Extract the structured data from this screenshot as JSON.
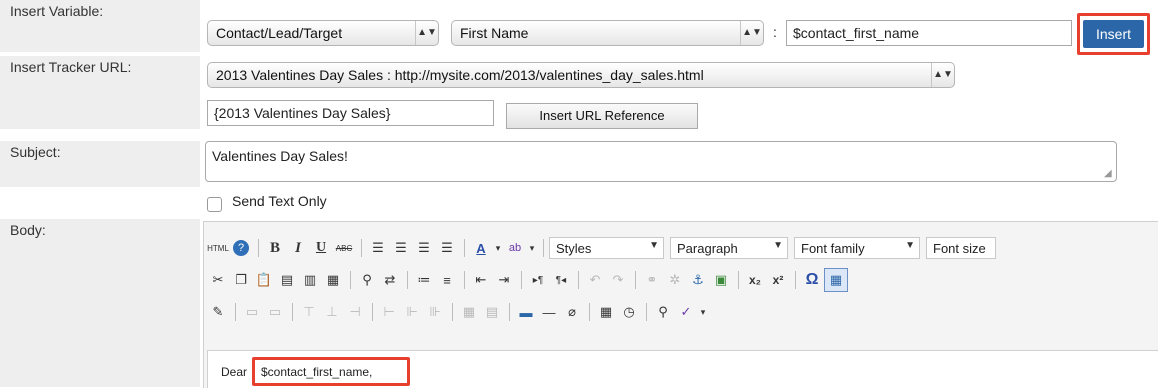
{
  "labels": {
    "insert_variable": "Insert Variable:",
    "insert_tracker": "Insert Tracker URL:",
    "subject": "Subject:",
    "body": "Body:"
  },
  "insert_variable": {
    "module_select": "Contact/Lead/Target",
    "field_select": "First Name",
    "colon": ":",
    "variable_value": "$contact_first_name",
    "insert_button": "Insert"
  },
  "tracker": {
    "url_select": "2013 Valentines Day Sales : http://mysite.com/2013/valentines_day_sales.html",
    "reference_value": "{2013 Valentines Day Sales}",
    "insert_reference_button": "Insert URL Reference"
  },
  "subject": {
    "value": "Valentines Day Sales!"
  },
  "send_text_only": {
    "label": "Send Text Only",
    "checked": false
  },
  "toolbar": {
    "html_label": "HTML",
    "bold": "B",
    "italic": "I",
    "underline": "U",
    "strike": "ABC",
    "styles": "Styles",
    "paragraph": "Paragraph",
    "font_family": "Font family",
    "font_size": "Font size"
  },
  "editor": {
    "greeting_prefix": "Dear",
    "greeting_variable": "$contact_first_name,"
  },
  "colors": {
    "highlight": "#e8402f",
    "insert_button": "#2b66a8",
    "label_bg": "#eeeeee"
  }
}
